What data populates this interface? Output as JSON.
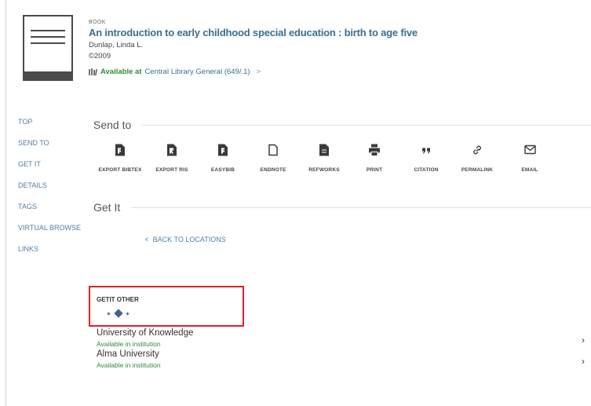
{
  "record": {
    "type": "BOOK",
    "title": "An introduction to early childhood special education : birth to age five",
    "author": "Dunlap, Linda L.",
    "date": "©2009",
    "availability": {
      "status": "Available at",
      "location": "Central Library  General (649/.1)",
      "arrow": ">"
    }
  },
  "nav": {
    "items": [
      "TOP",
      "SEND TO",
      "GET IT",
      "DETAILS",
      "TAGS",
      "VIRTUAL BROWSE",
      "LINKS"
    ]
  },
  "send_to": {
    "title": "Send to",
    "actions": [
      {
        "label": "EXPORT BIBTEX",
        "icon": "file-bibtex-icon"
      },
      {
        "label": "EXPORT RIS",
        "icon": "file-ris-icon"
      },
      {
        "label": "EASYBIB",
        "icon": "easybib-icon"
      },
      {
        "label": "ENDNOTE",
        "icon": "endnote-icon"
      },
      {
        "label": "REFWORKS",
        "icon": "refworks-icon"
      },
      {
        "label": "PRINT",
        "icon": "printer-icon"
      },
      {
        "label": "CITATION",
        "icon": "quote-icon"
      },
      {
        "label": "PERMALINK",
        "icon": "link-icon"
      },
      {
        "label": "EMAIL",
        "icon": "mail-icon"
      }
    ]
  },
  "get_it": {
    "title": "Get It",
    "back_label": "BACK TO LOCATIONS",
    "getit_other_label": "GETIT OTHER",
    "institutions": [
      {
        "name": "University of Knowledge",
        "status": "Available in institution"
      },
      {
        "name": "Alma University",
        "status": "Available in institution"
      }
    ]
  },
  "colors": {
    "link": "#4f7fa5",
    "title": "#3b6f8f",
    "available": "#2e8b3a",
    "highlight": "#e02020"
  }
}
